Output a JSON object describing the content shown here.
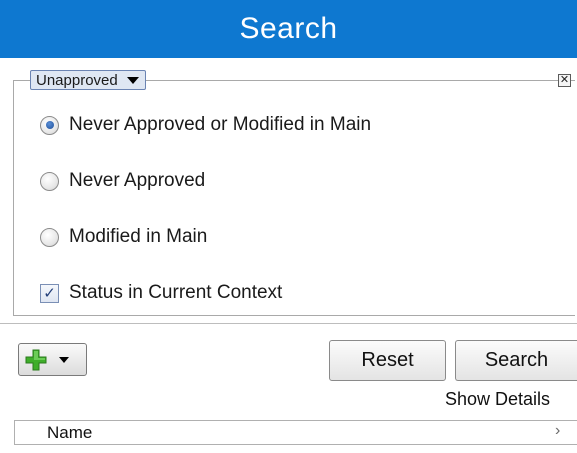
{
  "title": "Search",
  "filter": {
    "selected": "Unapproved",
    "close_glyph": "✕"
  },
  "options": [
    {
      "label": "Never Approved or Modified in Main",
      "checked": true
    },
    {
      "label": "Never Approved",
      "checked": false
    },
    {
      "label": "Modified in Main",
      "checked": false
    }
  ],
  "context_checkbox": {
    "label": "Status in Current Context",
    "checked": true,
    "glyph": "✓"
  },
  "toolbar": {
    "add_icon": "green-plus-icon",
    "reset_label": "Reset",
    "search_label": "Search",
    "show_details_label": "Show Details"
  },
  "results": {
    "column_header": "Name",
    "arrow_glyph": "›"
  },
  "colors": {
    "title_bar": "#0e78d0",
    "plus_green": "#3fae2a"
  }
}
